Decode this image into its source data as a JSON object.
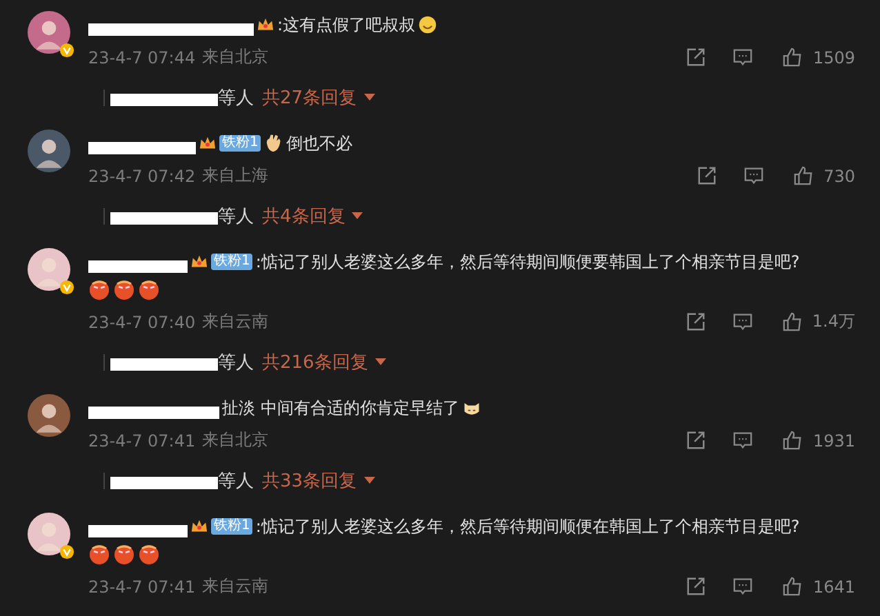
{
  "comments": [
    {
      "verified": true,
      "crown": true,
      "text": ":这有点假了吧叔叔",
      "trail_emoji": {
        "kind": "smile"
      },
      "date": "23-4-7 07:44",
      "location": "来自北京",
      "likes": "1509",
      "replies": {
        "suffix": "等人",
        "count": "共27条回复"
      }
    },
    {
      "verified": false,
      "crown": true,
      "badge": "铁粉1",
      "lead_emoji": {
        "kind": "hand"
      },
      "text": "倒也不必",
      "date": "23-4-7 07:42",
      "location": "来自上海",
      "likes": "730",
      "replies": {
        "suffix": "等人",
        "count": "共4条回复"
      }
    },
    {
      "verified": true,
      "crown": true,
      "badge": "铁粉1",
      "text": ":惦记了别人老婆这么多年，然后等待期间顺便要韩国上了个相亲节目是吧?",
      "emoji_row": [
        {
          "kind": "angry"
        },
        {
          "kind": "angry"
        },
        {
          "kind": "angry"
        }
      ],
      "date": "23-4-7 07:40",
      "location": "来自云南",
      "likes": "1.4万",
      "replies": {
        "suffix": "等人",
        "count": "共216条回复"
      }
    },
    {
      "verified": false,
      "crown": false,
      "text": "扯淡 中间有合适的你肯定早结了",
      "trail_emoji": {
        "kind": "cat"
      },
      "date": "23-4-7 07:41",
      "location": "来自北京",
      "likes": "1931",
      "replies": {
        "suffix": "等人",
        "count": "共33条回复"
      }
    },
    {
      "verified": true,
      "crown": true,
      "badge": "铁粉1",
      "text": ":惦记了别人老婆这么多年，然后等待期间顺便在韩国上了个相亲节目是吧?",
      "emoji_row": [
        {
          "kind": "angry"
        },
        {
          "kind": "angry"
        },
        {
          "kind": "angry"
        }
      ],
      "date": "23-4-7 07:41",
      "location": "来自云南",
      "likes": "1641"
    }
  ]
}
